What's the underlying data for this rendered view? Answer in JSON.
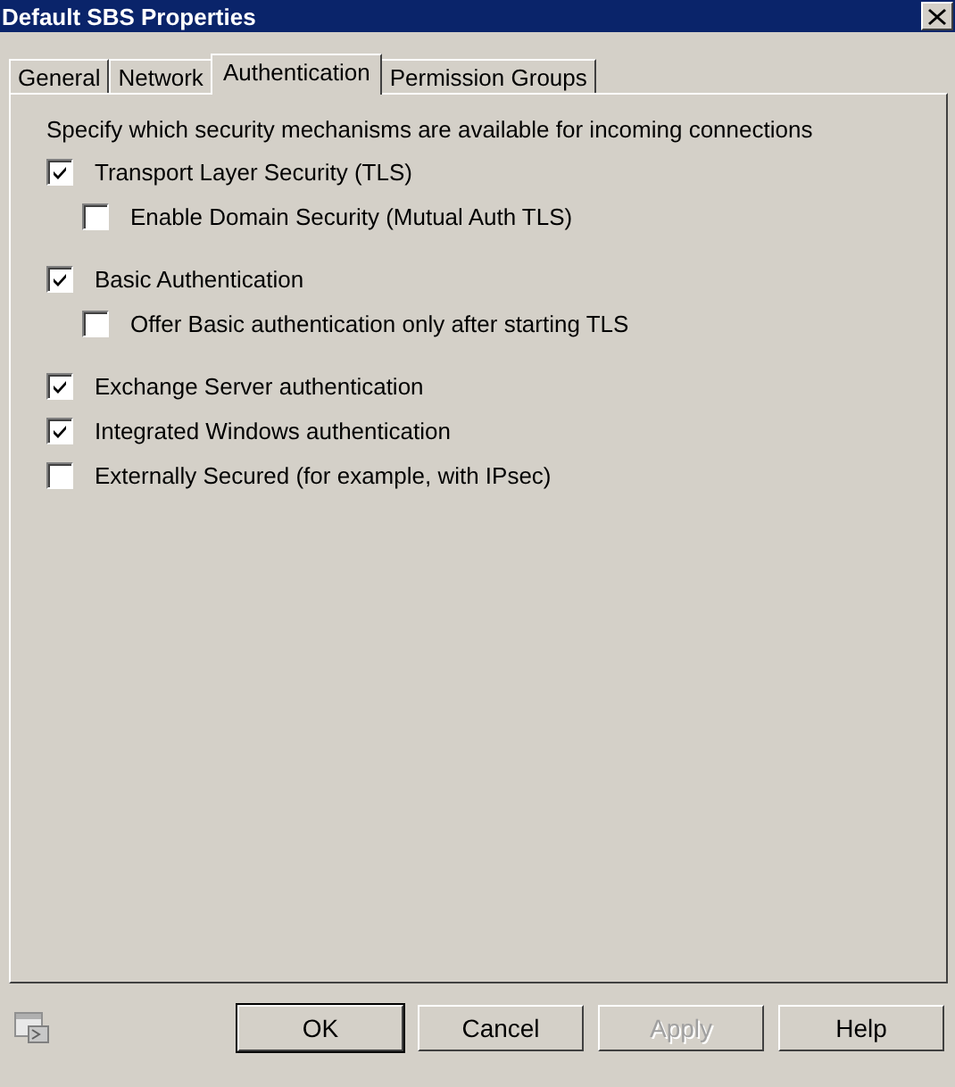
{
  "window": {
    "title": "Default SBS Properties"
  },
  "tabs": [
    {
      "label": "General",
      "selected": false
    },
    {
      "label": "Network",
      "selected": false
    },
    {
      "label": "Authentication",
      "selected": true
    },
    {
      "label": "Permission Groups",
      "selected": false
    }
  ],
  "intro": "Specify which security mechanisms are available for incoming connections",
  "groups": [
    [
      {
        "label": "Transport Layer Security (TLS)",
        "checked": true,
        "children": [
          {
            "label": "Enable Domain Security (Mutual Auth TLS)",
            "checked": false
          }
        ]
      }
    ],
    [
      {
        "label": "Basic Authentication",
        "checked": true,
        "children": [
          {
            "label": "Offer Basic authentication only after starting TLS",
            "checked": false
          }
        ]
      }
    ],
    [
      {
        "label": "Exchange Server authentication",
        "checked": true
      },
      {
        "label": "Integrated Windows authentication",
        "checked": true
      },
      {
        "label": "Externally Secured (for example, with IPsec)",
        "checked": false
      }
    ]
  ],
  "buttons": [
    {
      "label": "OK",
      "default": true,
      "disabled": false
    },
    {
      "label": "Cancel",
      "default": false,
      "disabled": false
    },
    {
      "label": "Apply",
      "default": false,
      "disabled": true
    },
    {
      "label": "Help",
      "default": false,
      "disabled": false
    }
  ]
}
